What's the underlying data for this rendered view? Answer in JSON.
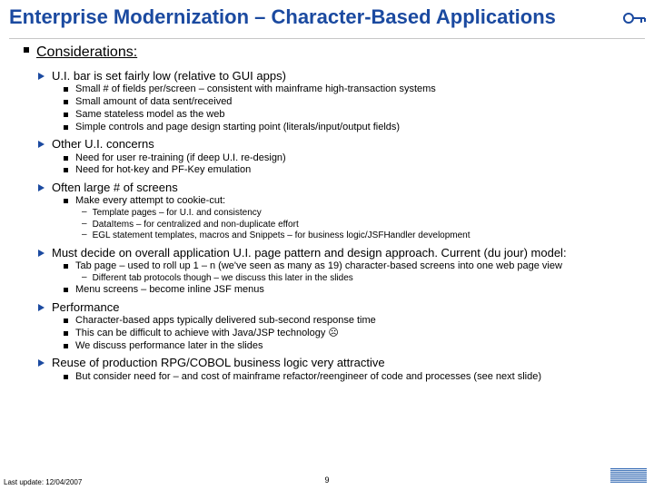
{
  "title": "Enterprise Modernization – Character-Based Applications",
  "section_heading": "Considerations:",
  "s1": {
    "h": "U.I. bar is set fairly low (relative to GUI apps)",
    "i1": "Small # of fields per/screen – consistent with mainframe high-transaction systems",
    "i2": "Small amount of data sent/received",
    "i3": "Same stateless model as the web",
    "i4": "Simple controls and page design starting point (literals/input/output fields)"
  },
  "s2": {
    "h": "Other U.I. concerns",
    "i1": "Need for user re-training (if deep U.I. re-design)",
    "i2": "Need for hot-key and PF-Key emulation"
  },
  "s3": {
    "h": "Often large # of screens",
    "i1": "Make every attempt to cookie-cut:",
    "d1": "Template pages – for U.I. and consistency",
    "d2": "DataItems – for centralized and non-duplicate effort",
    "d3": "EGL statement templates, macros and Snippets – for business logic/JSFHandler development"
  },
  "s4": {
    "h": "Must decide on overall application U.I. page pattern and design approach.  Current (du jour) model:",
    "i1": "Tab page – used to roll up 1 – n (we've seen as many as 19) character-based screens into one web page view",
    "d1": "Different tab protocols though – we discuss this later in the slides",
    "i2": "Menu screens – become inline JSF menus"
  },
  "s5": {
    "h": "Performance",
    "i1": "Character-based apps typically delivered sub-second response time",
    "i2": "This can be difficult to achieve with Java/JSP technology  ☹",
    "i3": "We discuss performance later in the slides"
  },
  "s6": {
    "h": "Reuse of production RPG/COBOL business logic very attractive",
    "i1": "But consider need for – and cost of mainframe refactor/reengineer of code and processes (see next slide)"
  },
  "footer": {
    "last_update": "Last update: 12/04/2007",
    "page_number": "9",
    "logo_text": "IBM"
  }
}
